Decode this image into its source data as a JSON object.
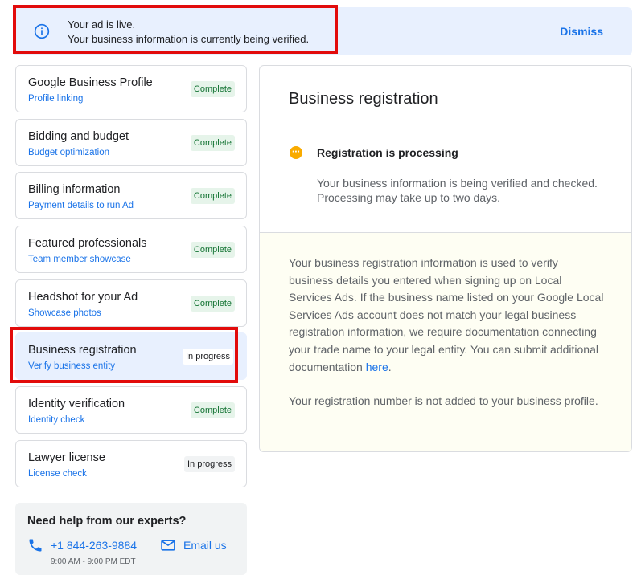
{
  "banner": {
    "line1": "Your ad is live.",
    "line2": "Your business information is currently being verified.",
    "dismiss_label": "Dismiss",
    "icon": "info-icon"
  },
  "steps": [
    {
      "title": "Google Business Profile",
      "subtitle": "Profile linking",
      "status": "Complete"
    },
    {
      "title": "Bidding and budget",
      "subtitle": "Budget optimization",
      "status": "Complete"
    },
    {
      "title": "Billing information",
      "subtitle": "Payment details to run Ad",
      "status": "Complete"
    },
    {
      "title": "Featured professionals",
      "subtitle": "Team member showcase",
      "status": "Complete"
    },
    {
      "title": "Headshot for your Ad",
      "subtitle": "Showcase photos",
      "status": "Complete"
    },
    {
      "title": "Business registration",
      "subtitle": "Verify business entity",
      "status": "In progress"
    },
    {
      "title": "Identity verification",
      "subtitle": "Identity check",
      "status": "Complete"
    },
    {
      "title": "Lawyer license",
      "subtitle": "License check",
      "status": "In progress"
    }
  ],
  "help": {
    "title": "Need help from our experts?",
    "phone": "+1 844-263-9884",
    "email_label": "Email us",
    "hours": "9:00 AM - 9:00 PM EDT"
  },
  "detail": {
    "title": "Business registration",
    "status_title": "Registration is processing",
    "status_desc": "Your business information is being verified and checked. Processing may take up to two days.",
    "body_text": "Your business registration information is used to verify business details you entered when signing up on Local Services Ads. If the business name listed on your Google Local Services Ads account does not match your legal business registration information, we require documentation connecting your trade name to your legal entity. You can submit additional documentation",
    "body_link": "here",
    "body_end": ".",
    "note": "Your registration number is not added to your business profile."
  },
  "colors": {
    "accent": "#1a73e8",
    "complete_bg": "#e6f4ea",
    "complete_text": "#137333",
    "warning": "#f9ab00",
    "highlight": "#e20b0b"
  }
}
